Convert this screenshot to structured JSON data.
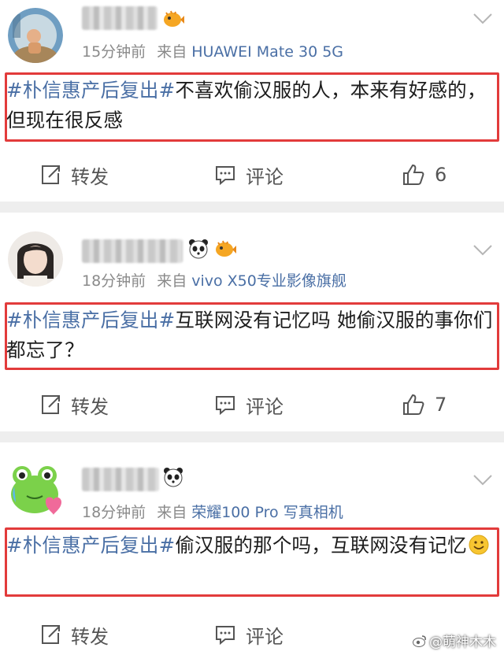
{
  "posts": [
    {
      "time": "15分钟前",
      "source_prefix": "来自",
      "device": "HUAWEI Mate 30 5G",
      "hashtag": "#朴信惠产后复出#",
      "body": "不喜欢偷汉服的人，本来有好感的，但现在很反感",
      "repost_label": "转发",
      "comment_label": "评论",
      "like_count": "6",
      "user_badges": [
        "pufferfish-emoji"
      ]
    },
    {
      "time": "18分钟前",
      "source_prefix": "来自",
      "device": "vivo X50专业影像旗舰",
      "hashtag": "#朴信惠产后复出#",
      "body": "互联网没有记忆吗 她偷汉服的事你们都忘了？",
      "repost_label": "转发",
      "comment_label": "评论",
      "like_count": "7",
      "user_badges": [
        "panda-emoji",
        "pufferfish-emoji"
      ]
    },
    {
      "time": "18分钟前",
      "source_prefix": "来自",
      "device": "荣耀100 Pro 写真相机",
      "hashtag": "#朴信惠产后复出#",
      "body": "偷汉服的那个吗，互联网没有记忆",
      "body_emoji": "smile-emoji",
      "repost_label": "转发",
      "comment_label": "评论",
      "like_count": "",
      "user_badges": [
        "panda-emoji"
      ]
    }
  ],
  "watermark": "@萌神木木",
  "colors": {
    "highlight_border": "#e23b3b",
    "link": "#4a6fa5",
    "meta": "#8a8a8a"
  }
}
